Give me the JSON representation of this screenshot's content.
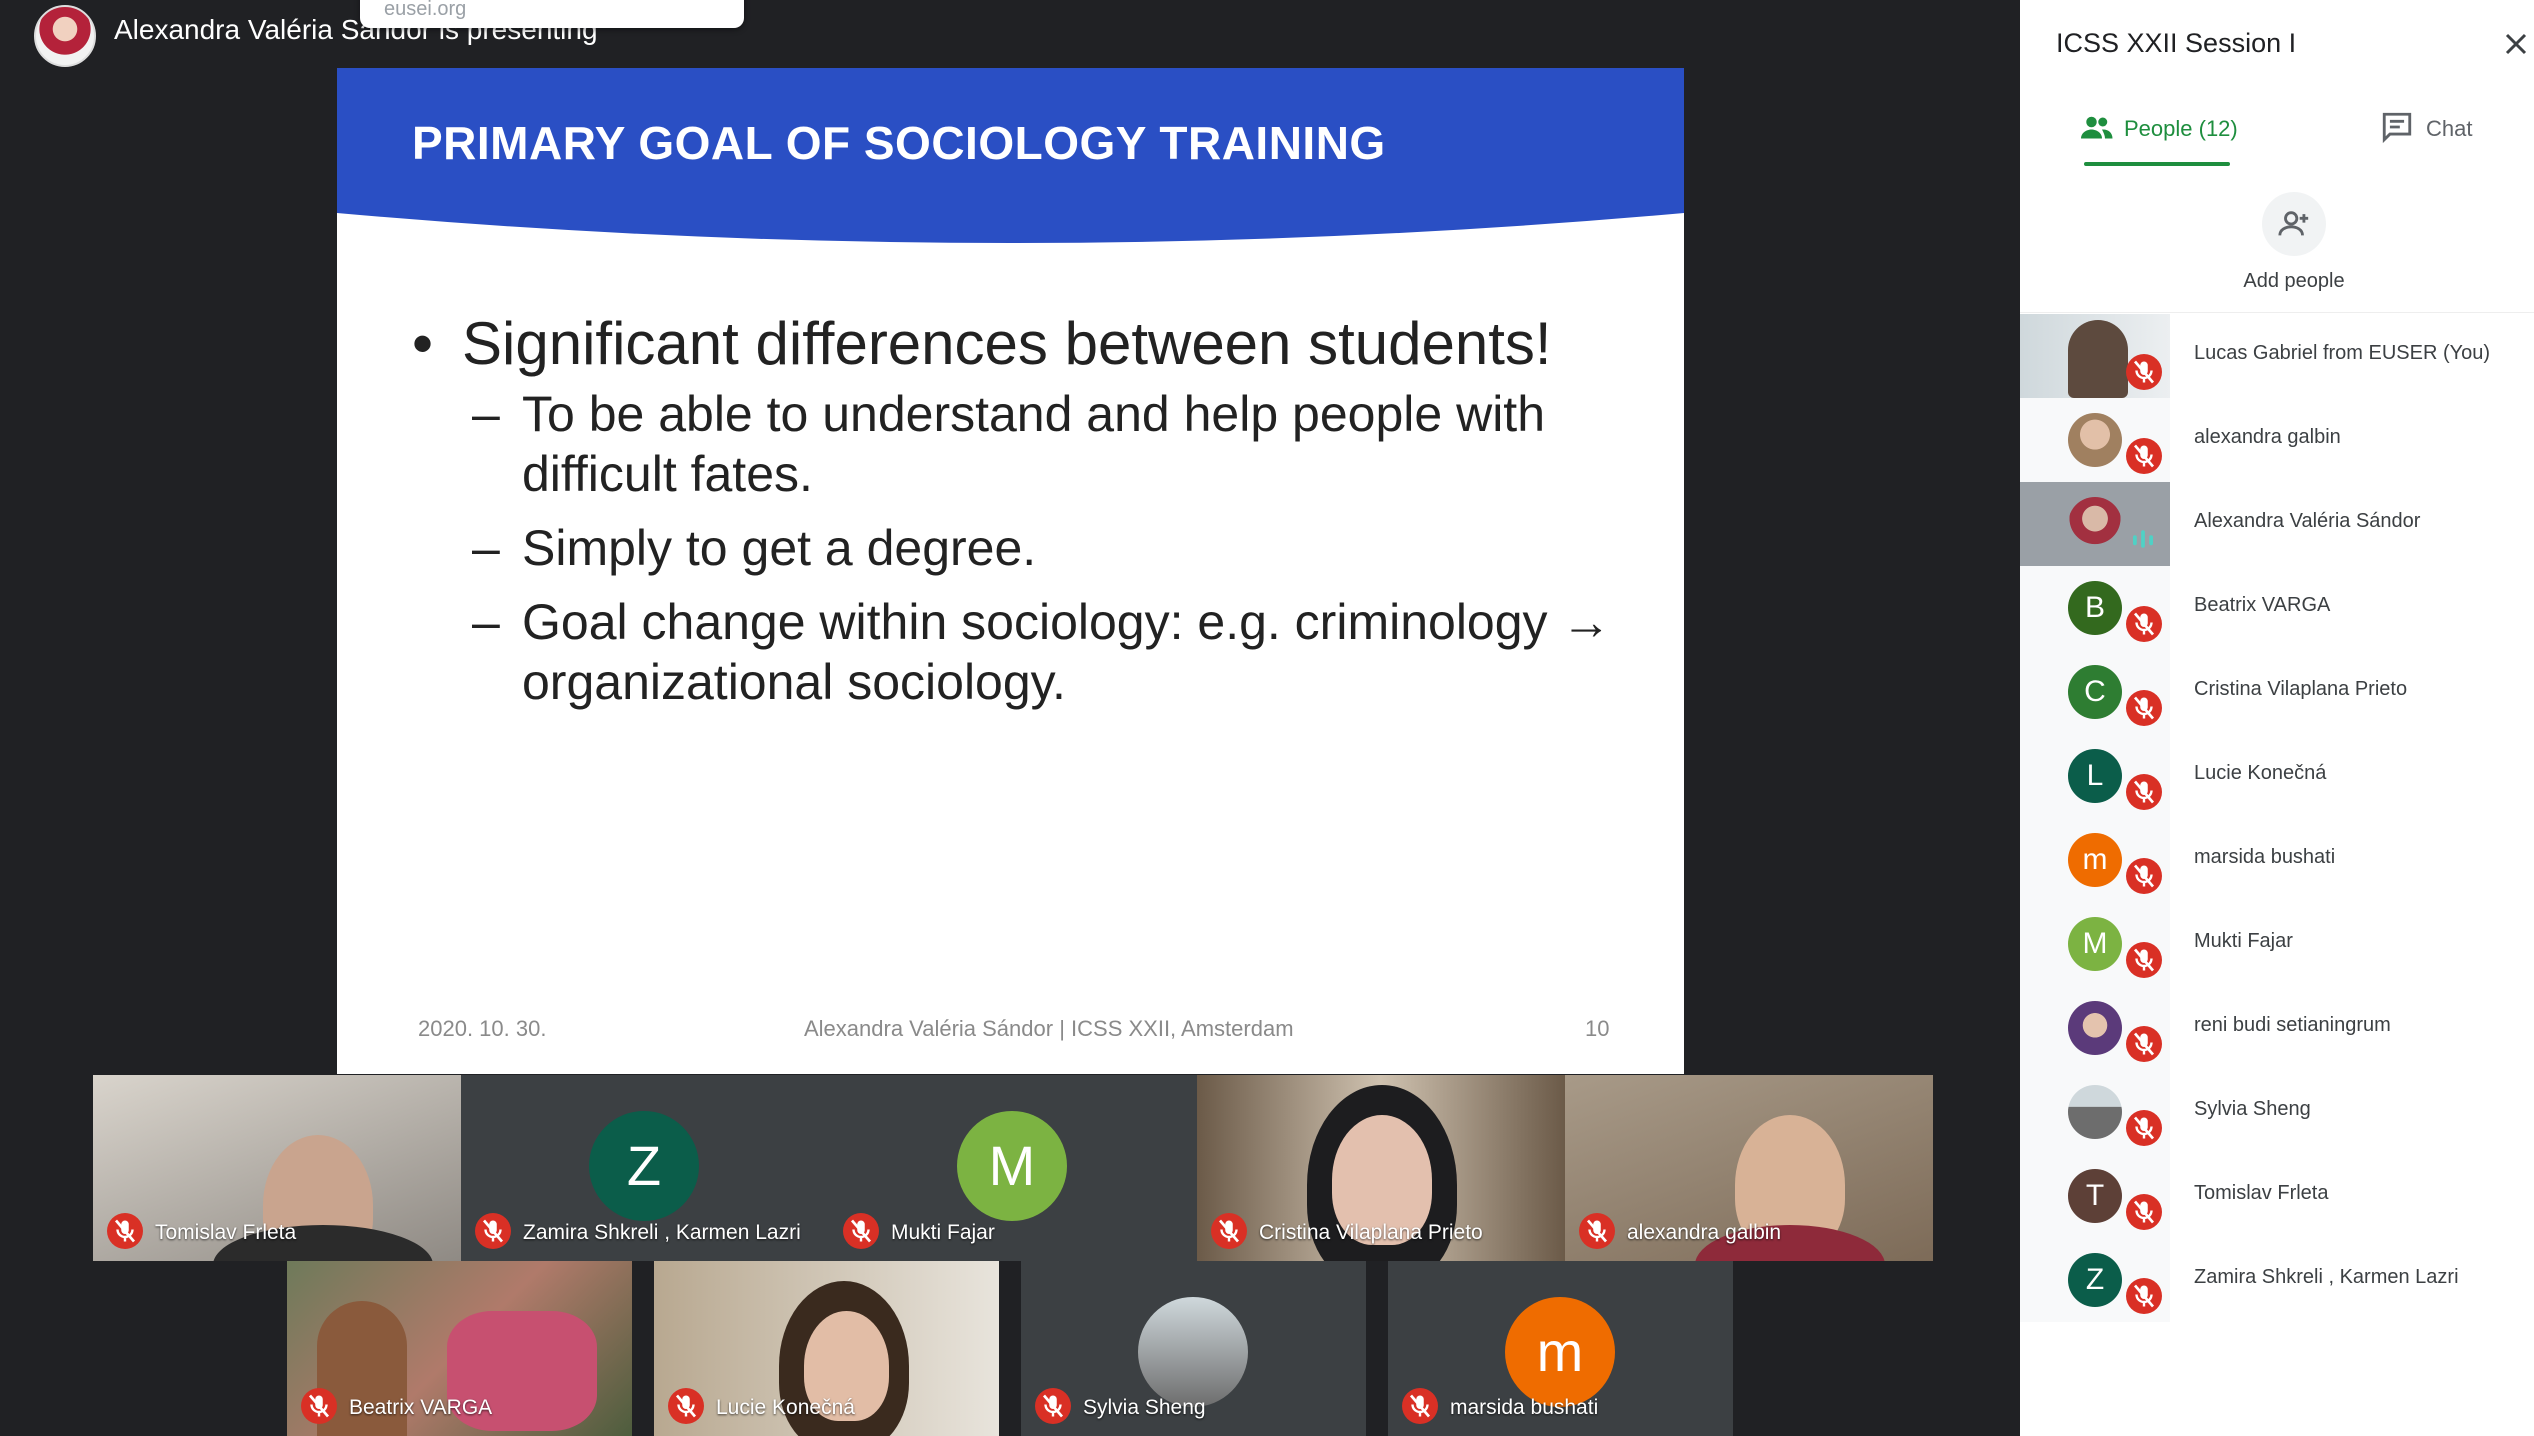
{
  "presenter": {
    "text": "Alexandra Valéria Sándor is presenting",
    "url_chip": "eusei.org"
  },
  "slide": {
    "title": "PRIMARY GOAL OF SOCIOLOGY TRAINING",
    "bullet": "•",
    "main_point": "Significant differences between students!",
    "dash": "–",
    "sub_points": [
      "To be able to understand and help people with difficult fates.",
      "Simply to get a degree.",
      "Goal change within sociology: e.g. criminology → organizational sociology."
    ],
    "footer_date": "2020. 10. 30.",
    "footer_center": "Alexandra Valéria Sándor | ICSS XXII, Amsterdam",
    "footer_page": "10",
    "colors": {
      "header": "#2a4fc4"
    }
  },
  "tiles": {
    "row1": [
      {
        "name": "Tomislav Frleta",
        "kind": "camera"
      },
      {
        "name": "Zamira Shkreli , Karmen Lazri",
        "kind": "letter",
        "letter": "Z",
        "color": "#0b5d4a"
      },
      {
        "name": "Mukti Fajar",
        "kind": "letter",
        "letter": "M",
        "color": "#7cb342"
      },
      {
        "name": "Cristina Vilaplana Prieto",
        "kind": "camera"
      },
      {
        "name": "alexandra galbin",
        "kind": "camera"
      }
    ],
    "row2": [
      {
        "name": "Beatrix VARGA",
        "kind": "camera"
      },
      {
        "name": "Lucie Konečná",
        "kind": "camera"
      },
      {
        "name": "Sylvia Sheng",
        "kind": "photo"
      },
      {
        "name": "marsida bushati",
        "kind": "letter",
        "letter": "m",
        "color": "#ef6c00"
      }
    ]
  },
  "sidebar": {
    "title": "ICSS XXII Session I",
    "close_icon": "close-icon",
    "tabs": {
      "people": "People (12)",
      "chat": "Chat"
    },
    "add_people": "Add people",
    "people": [
      {
        "name": "Lucas Gabriel from EUSER (You)",
        "type": "photo",
        "muted": true
      },
      {
        "name": "alexandra galbin",
        "type": "photo",
        "muted": true
      },
      {
        "name": "Alexandra Valéria Sándor",
        "type": "speaking",
        "muted": false
      },
      {
        "name": "Beatrix VARGA",
        "type": "letter",
        "letter": "B",
        "color": "#33691e",
        "muted": true
      },
      {
        "name": "Cristina Vilaplana Prieto",
        "type": "letter",
        "letter": "C",
        "color": "#2e7d32",
        "muted": true
      },
      {
        "name": "Lucie Konečná",
        "type": "letter",
        "letter": "L",
        "color": "#0b5d4a",
        "muted": true
      },
      {
        "name": "marsida bushati",
        "type": "letter",
        "letter": "m",
        "color": "#ef6c00",
        "muted": true
      },
      {
        "name": "Mukti Fajar",
        "type": "letter",
        "letter": "M",
        "color": "#7cb342",
        "muted": true
      },
      {
        "name": "reni budi setianingrum",
        "type": "photo",
        "muted": true
      },
      {
        "name": "Sylvia Sheng",
        "type": "photo",
        "muted": true
      },
      {
        "name": "Tomislav Frleta",
        "type": "letter",
        "letter": "T",
        "color": "#5d4037",
        "muted": true
      },
      {
        "name": "Zamira Shkreli , Karmen Lazri",
        "type": "letter",
        "letter": "Z",
        "color": "#0b5d4a",
        "muted": true
      }
    ]
  }
}
